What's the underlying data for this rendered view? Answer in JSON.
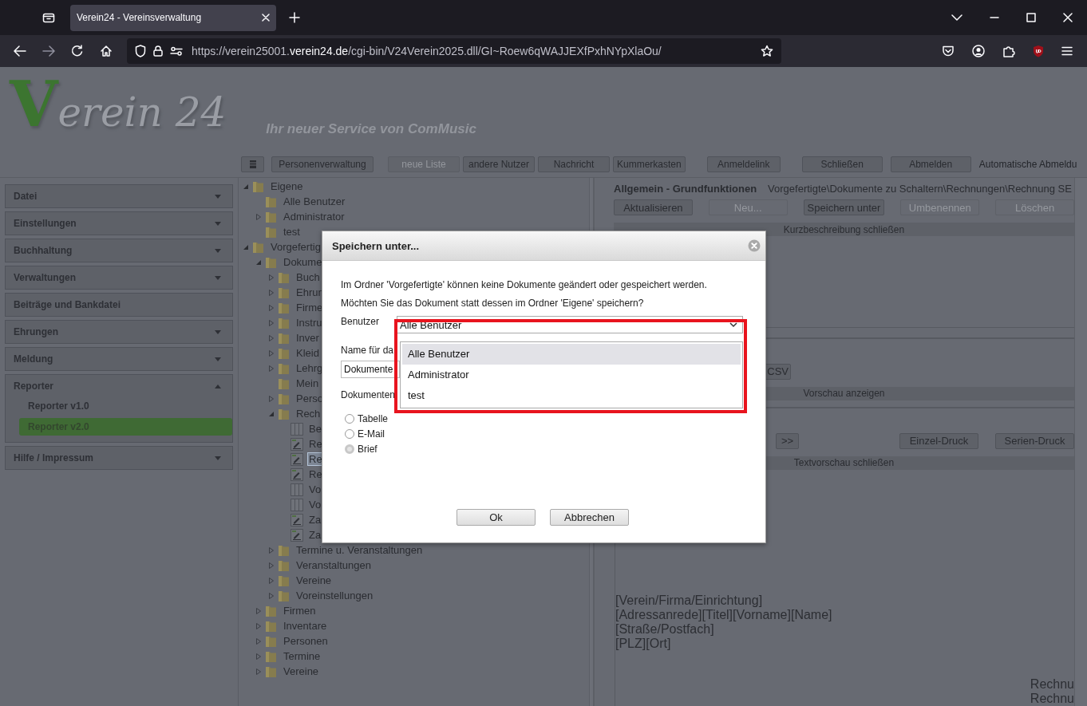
{
  "browser": {
    "tab_title": "Verein24 - Vereinsverwaltung",
    "url": "https://verein25001.**verein24.de**/cgi-bin/V24Verein2025.dll/GI~Roew6qWAJJEXfPxhNYpXlaOu/"
  },
  "header": {
    "logo": "Verein 24",
    "slogan": "Ihr neuer Service von ComMusic"
  },
  "toolbar": [
    {
      "kind": "icon",
      "disabled": false
    },
    {
      "kind": "text",
      "label": "Personenverwaltung",
      "disabled": false
    },
    {
      "kind": "text",
      "label": "neue Liste",
      "disabled": true
    },
    {
      "kind": "text",
      "label": "andere Nutzer",
      "disabled": false
    },
    {
      "kind": "text",
      "label": "Nachricht",
      "disabled": false
    },
    {
      "kind": "text",
      "label": "Kummerkasten",
      "disabled": false
    },
    {
      "kind": "text",
      "label": "Anmeldelink",
      "disabled": false
    },
    {
      "kind": "text",
      "label": "Schließen",
      "disabled": false
    },
    {
      "kind": "text",
      "label": "Abmelden",
      "disabled": false
    }
  ],
  "auto_logout": "Automatische Abmeldu",
  "sidebar": [
    {
      "kind": "group",
      "label": "Datei",
      "expanded": false
    },
    {
      "kind": "group",
      "label": "Einstellungen",
      "expanded": false
    },
    {
      "kind": "group",
      "label": "Buchhaltung",
      "expanded": false
    },
    {
      "kind": "group",
      "label": "Verwaltungen",
      "expanded": false
    },
    {
      "kind": "link",
      "label": "Beiträge und Bankdatei"
    },
    {
      "kind": "group",
      "label": "Ehrungen",
      "expanded": false
    },
    {
      "kind": "group",
      "label": "Meldung",
      "expanded": false
    },
    {
      "kind": "group",
      "label": "Reporter",
      "expanded": true,
      "children": [
        {
          "label": "Reporter v1.0",
          "selected": false
        },
        {
          "label": "Reporter v2.0",
          "selected": true
        }
      ]
    },
    {
      "kind": "group",
      "label": "Hilfe / Impressum",
      "expanded": false
    }
  ],
  "tree": [
    {
      "label": "Eigene",
      "kind": "folder",
      "expanded": true,
      "selected": false,
      "children": [
        {
          "label": "Alle Benutzer",
          "kind": "folder",
          "selected": false
        },
        {
          "label": "Administrator",
          "kind": "folder",
          "expanded": false,
          "selected": false
        },
        {
          "label": "test",
          "kind": "folder",
          "selected": false
        }
      ]
    },
    {
      "label": "Vorgefertig",
      "kind": "folder",
      "expanded": true,
      "selected": false,
      "children": [
        {
          "label": "Dokume",
          "kind": "folder",
          "expanded": true,
          "selected": false,
          "children": [
            {
              "label": "Buch",
              "kind": "folder",
              "expanded": false,
              "selected": false
            },
            {
              "label": "Ehrun",
              "kind": "folder",
              "expanded": false,
              "selected": false
            },
            {
              "label": "Firme",
              "kind": "folder",
              "expanded": false,
              "selected": false
            },
            {
              "label": "Instru",
              "kind": "folder",
              "expanded": false,
              "selected": false
            },
            {
              "label": "Inver",
              "kind": "folder",
              "expanded": false,
              "selected": false
            },
            {
              "label": "Kleid",
              "kind": "folder",
              "expanded": false,
              "selected": false
            },
            {
              "label": "Lehrg",
              "kind": "folder",
              "expanded": false,
              "selected": false
            },
            {
              "label": "Mein",
              "kind": "folder",
              "selected": false
            },
            {
              "label": "Perso",
              "kind": "folder",
              "expanded": false,
              "selected": false
            },
            {
              "label": "Rech",
              "kind": "folder",
              "expanded": true,
              "selected": false,
              "children": [
                {
                  "label": "Be",
                  "kind": "table",
                  "selected": false
                },
                {
                  "label": "Re",
                  "kind": "letter",
                  "selected": false
                },
                {
                  "label": "Re",
                  "kind": "letter",
                  "selected": true
                },
                {
                  "label": "Re",
                  "kind": "letter",
                  "selected": false
                },
                {
                  "label": "Vo",
                  "kind": "table",
                  "selected": false
                },
                {
                  "label": "Vo",
                  "kind": "table",
                  "selected": false
                },
                {
                  "label": "Za",
                  "kind": "letter",
                  "selected": false
                },
                {
                  "label": "Za",
                  "kind": "letter",
                  "selected": false
                }
              ]
            },
            {
              "label": "Termine u. Veranstaltungen",
              "kind": "folder",
              "expanded": false,
              "selected": false
            },
            {
              "label": "Veranstaltungen",
              "kind": "folder",
              "expanded": false,
              "selected": false
            },
            {
              "label": "Vereine",
              "kind": "folder",
              "expanded": false,
              "selected": false
            },
            {
              "label": "Voreinstellungen",
              "kind": "folder",
              "expanded": false,
              "selected": false
            }
          ]
        },
        {
          "label": "Firmen",
          "kind": "folder",
          "expanded": false,
          "selected": false
        },
        {
          "label": "Inventare",
          "kind": "folder",
          "expanded": false,
          "selected": false
        },
        {
          "label": "Personen",
          "kind": "folder",
          "expanded": false,
          "selected": false
        },
        {
          "label": "Termine",
          "kind": "folder",
          "expanded": false,
          "selected": false
        },
        {
          "label": "Vereine",
          "kind": "folder",
          "expanded": false,
          "selected": false
        }
      ]
    }
  ],
  "panel": {
    "title": "Allgemein - Grundfunktionen",
    "path": "Vorgefertigte\\Dokumente zu Schaltern\\Rechnungen\\Rechnung SE",
    "actions": [
      {
        "label": "Aktualisieren",
        "disabled": false
      },
      {
        "label": "Neu...",
        "disabled": true
      },
      {
        "label": "Speichern unter",
        "disabled": false
      },
      {
        "label": "Umbenennen",
        "disabled": true
      },
      {
        "label": "Löschen",
        "disabled": true
      }
    ],
    "description_bar": "Kurzbeschreibung schließen",
    "export_button": "CSV",
    "preview_bar": "Vorschau anzeigen",
    "next_button": ">>",
    "print_buttons": [
      "Einzel-Druck",
      "Serien-Druck"
    ],
    "text_preview_bar": "Textvorschau schließen",
    "address_lines": [
      "[Verein/Firma/Einrichtung]",
      "[Adressanrede][Titel][Vorname][Name]",
      "[Straße/Postfach]",
      "[PLZ][Ort]"
    ],
    "right_lines": [
      "Rechnu",
      "Rechnu"
    ]
  },
  "dialog": {
    "title": "Speichern unter...",
    "message_lines": [
      "Im Ordner 'Vorgefertigte' können keine Dokumente geändert oder gespeichert werden.",
      "Möchten Sie das Dokument statt dessen im Ordner 'Eigene' speichern?"
    ],
    "user_label": "Benutzer",
    "user_value": "Alle Benutzer",
    "options": [
      {
        "label": "Alle Benutzer",
        "selected": true
      },
      {
        "label": "Administrator",
        "selected": false
      },
      {
        "label": "test",
        "selected": false
      }
    ],
    "name_label": "Name für da",
    "name_value": "Dokumente",
    "type_label": "Dokumenten",
    "types": [
      {
        "label": "Tabelle",
        "selected": false
      },
      {
        "label": "E-Mail",
        "selected": false
      },
      {
        "label": "Brief",
        "selected": true
      }
    ],
    "buttons": [
      "Ok",
      "Abbrechen"
    ]
  }
}
